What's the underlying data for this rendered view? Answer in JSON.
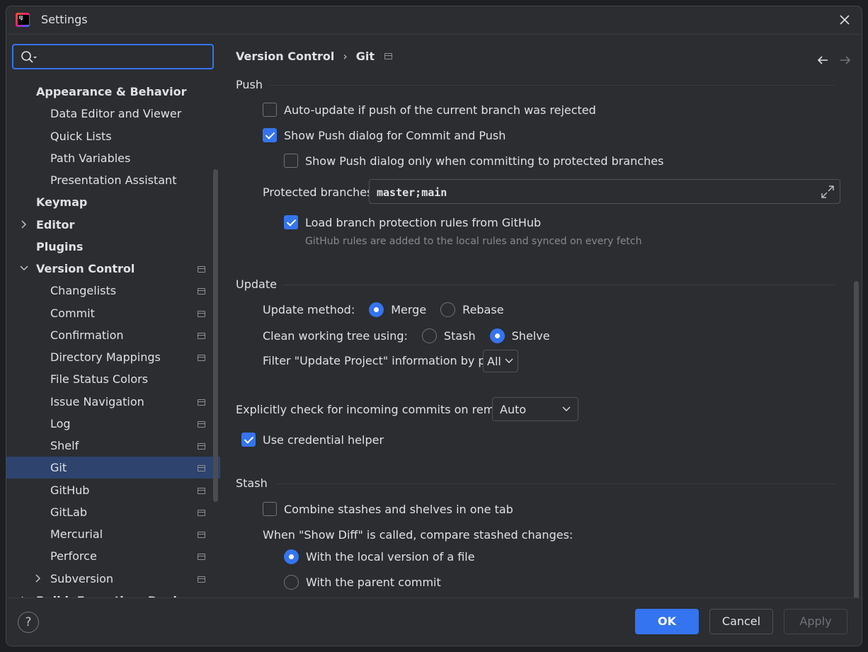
{
  "window": {
    "title": "Settings"
  },
  "search": {
    "placeholder": ""
  },
  "sidebar": {
    "items": [
      {
        "label": "Appearance & Behavior",
        "bold": true,
        "indent": 0
      },
      {
        "label": "Data Editor and Viewer",
        "indent": 1
      },
      {
        "label": "Quick Lists",
        "indent": 1
      },
      {
        "label": "Path Variables",
        "indent": 1
      },
      {
        "label": "Presentation Assistant",
        "indent": 1
      },
      {
        "label": "Keymap",
        "bold": true,
        "indent": 0
      },
      {
        "label": "Editor",
        "bold": true,
        "indent": 0,
        "chevron": "right"
      },
      {
        "label": "Plugins",
        "bold": true,
        "indent": 0
      },
      {
        "label": "Version Control",
        "bold": true,
        "indent": 0,
        "chevron": "down",
        "pin": true
      },
      {
        "label": "Changelists",
        "indent": 1,
        "pin": true
      },
      {
        "label": "Commit",
        "indent": 1,
        "pin": true
      },
      {
        "label": "Confirmation",
        "indent": 1,
        "pin": true
      },
      {
        "label": "Directory Mappings",
        "indent": 1,
        "pin": true
      },
      {
        "label": "File Status Colors",
        "indent": 1
      },
      {
        "label": "Issue Navigation",
        "indent": 1,
        "pin": true
      },
      {
        "label": "Log",
        "indent": 1,
        "pin": true
      },
      {
        "label": "Shelf",
        "indent": 1,
        "pin": true
      },
      {
        "label": "Git",
        "indent": 1,
        "pin": true,
        "selected": true
      },
      {
        "label": "GitHub",
        "indent": 1,
        "pin": true
      },
      {
        "label": "GitLab",
        "indent": 1,
        "pin": true
      },
      {
        "label": "Mercurial",
        "indent": 1,
        "pin": true
      },
      {
        "label": "Perforce",
        "indent": 1,
        "pin": true
      },
      {
        "label": "Subversion",
        "indent": 1,
        "pin": true,
        "chevron": "right"
      },
      {
        "label": "Build, Execution, Deployment",
        "bold": true,
        "indent": 0,
        "chevron": "right"
      }
    ]
  },
  "breadcrumb": {
    "parent": "Version Control",
    "separator": "›",
    "current": "Git"
  },
  "push": {
    "title": "Push",
    "auto_update": {
      "label": "Auto-update if push of the current branch was rejected",
      "checked": false
    },
    "show_push_dialog": {
      "label": "Show Push dialog for Commit and Push",
      "checked": true
    },
    "show_push_protected": {
      "label": "Show Push dialog only when committing to protected branches",
      "checked": false
    },
    "protected_label": "Protected branches:",
    "protected_value": "master;main",
    "load_rules": {
      "label": "Load branch protection rules from GitHub",
      "checked": true
    },
    "load_rules_hint": "GitHub rules are added to the local rules and synced on every fetch"
  },
  "update": {
    "title": "Update",
    "method_label": "Update method:",
    "method_merge": "Merge",
    "method_rebase": "Rebase",
    "method_selected": "Merge",
    "clean_label": "Clean working tree using:",
    "clean_stash": "Stash",
    "clean_shelve": "Shelve",
    "clean_selected": "Shelve",
    "filter_label": "Filter \"Update Project\" information by paths:",
    "filter_value": "All"
  },
  "incoming": {
    "label": "Explicitly check for incoming commits on remotes:",
    "value": "Auto"
  },
  "credential": {
    "label": "Use credential helper",
    "checked": true
  },
  "stash": {
    "title": "Stash",
    "combine": {
      "label": "Combine stashes and shelves in one tab",
      "checked": false
    },
    "compare_label": "When \"Show Diff\" is called, compare stashed changes:",
    "opt_local": "With the local version of a file",
    "opt_parent": "With the parent commit",
    "selected": "local"
  },
  "footer": {
    "help": "?",
    "ok": "OK",
    "cancel": "Cancel",
    "apply": "Apply"
  },
  "colors": {
    "accent": "#3574f0",
    "background": "#2b2d30",
    "selection": "#2e436e"
  }
}
